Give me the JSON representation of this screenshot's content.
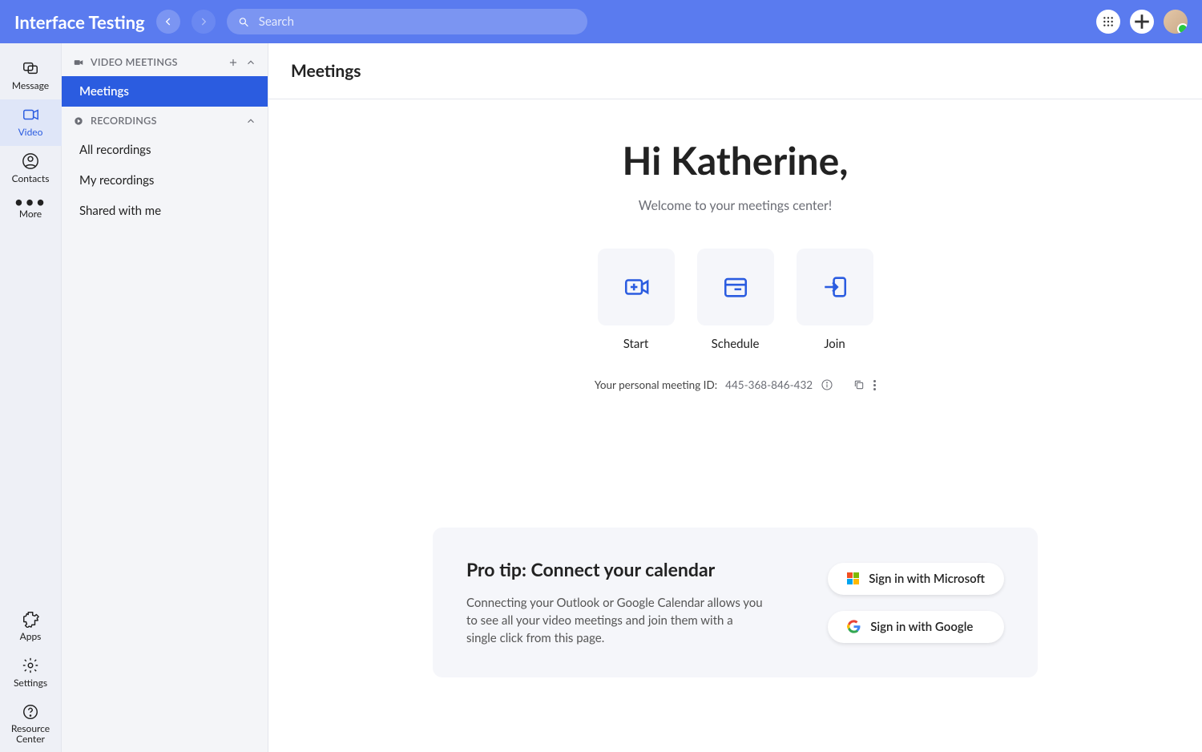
{
  "header": {
    "app_title": "Interface Testing",
    "search_placeholder": "Search"
  },
  "rail": {
    "message": "Message",
    "video": "Video",
    "contacts": "Contacts",
    "more": "More",
    "apps": "Apps",
    "settings": "Settings",
    "resource_center": "Resource Center"
  },
  "panel": {
    "video_meetings": "VIDEO MEETINGS",
    "meetings": "Meetings",
    "recordings": "RECORDINGS",
    "all_recordings": "All recordings",
    "my_recordings": "My recordings",
    "shared_with_me": "Shared with me"
  },
  "main": {
    "title": "Meetings",
    "greeting": "Hi Katherine,",
    "subtitle": "Welcome to your meetings center!",
    "tiles": {
      "start": "Start",
      "schedule": "Schedule",
      "join": "Join"
    },
    "pmi_label": "Your personal meeting ID:",
    "pmi_value": "445-368-846-432"
  },
  "tip": {
    "title": "Pro tip: Connect your calendar",
    "body": "Connecting your Outlook or Google Calendar allows you to see all your video meetings and join them with a single click from this page.",
    "microsoft": "Sign in with Microsoft",
    "google": "Sign in with Google"
  }
}
